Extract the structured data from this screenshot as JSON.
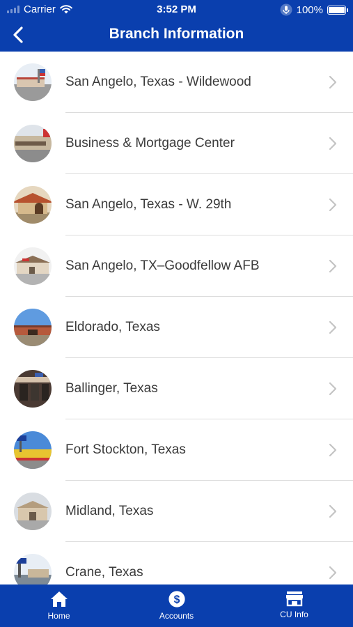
{
  "status_bar": {
    "carrier": "Carrier",
    "time": "3:52 PM",
    "battery": "100%"
  },
  "header": {
    "title": "Branch Information"
  },
  "branches": [
    {
      "label": "San Angelo, Texas - Wildewood"
    },
    {
      "label": "Business & Mortgage Center"
    },
    {
      "label": "San Angelo, Texas - W. 29th"
    },
    {
      "label": "San Angelo, TX–Goodfellow AFB"
    },
    {
      "label": "Eldorado, Texas"
    },
    {
      "label": "Ballinger, Texas"
    },
    {
      "label": "Fort Stockton, Texas"
    },
    {
      "label": "Midland, Texas"
    },
    {
      "label": "Crane, Texas"
    }
  ],
  "tabbar": {
    "home": "Home",
    "accounts": "Accounts",
    "cu_info": "CU Info"
  },
  "colors": {
    "brand_blue": "#0a3fae",
    "text": "#3b3b3b",
    "separator": "#dcdcdc",
    "chevron": "#c4c4c4"
  }
}
